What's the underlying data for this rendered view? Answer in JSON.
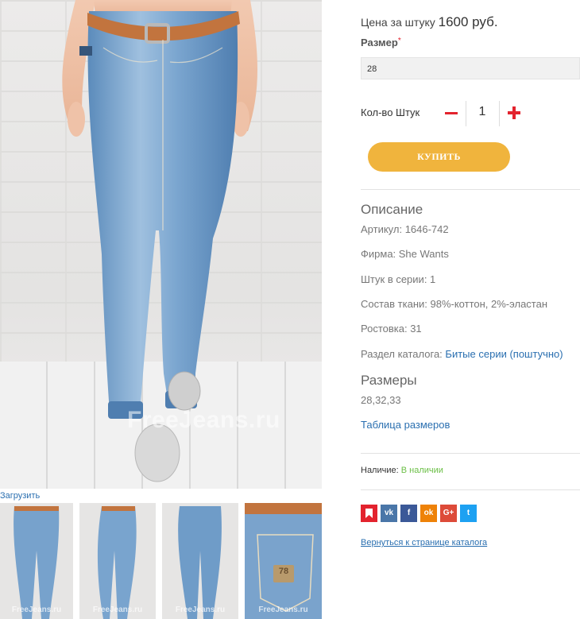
{
  "gallery": {
    "watermark": "FreeJeans.ru",
    "upload_label": "Загрузить",
    "thumb_watermark": "FreeJeans.ru",
    "patch_text": "78"
  },
  "product": {
    "price_prefix": "Цена за штуку",
    "price_value": "1600 руб.",
    "size_label": "Размер",
    "size_required_mark": "*",
    "size_selected": "28",
    "qty_label": "Кол-во Штук",
    "qty_value": "1",
    "buy_label": "КУПИТЬ"
  },
  "description": {
    "title": "Описание",
    "article": "Артикул: 1646-742",
    "brand": "Фирма: She Wants",
    "per_series": "Штук в серии: 1",
    "fabric": "Состав ткани: 98%-коттон, 2%-эластан",
    "height": "Ростовка: 31",
    "catalog_prefix": "Раздел каталога:",
    "catalog_link": "Битые серии (поштучно)"
  },
  "sizes": {
    "title": "Размеры",
    "list": "28,32,33",
    "table_link": "Таблица размеров"
  },
  "availability": {
    "label": "Наличие:",
    "status": "В наличии"
  },
  "social": {
    "items": [
      {
        "icon": "bookmark-icon",
        "text": "",
        "color": "#e3232e"
      },
      {
        "icon": "vk-icon",
        "text": "vk",
        "color": "#4a76a8"
      },
      {
        "icon": "facebook-icon",
        "text": "f",
        "color": "#3b5998"
      },
      {
        "icon": "odnoklassniki-icon",
        "text": "ok",
        "color": "#ee8208"
      },
      {
        "icon": "google-plus-icon",
        "text": "G+",
        "color": "#dd4b39"
      },
      {
        "icon": "twitter-icon",
        "text": "t",
        "color": "#1da1f2"
      }
    ]
  },
  "back_link": "Вернуться к странице каталога",
  "colors": {
    "accent_red": "#e3232e",
    "buy_button": "#f0b43d",
    "link": "#2a6fb0",
    "in_stock": "#6bbf46",
    "denim": "#6f9cc8"
  }
}
